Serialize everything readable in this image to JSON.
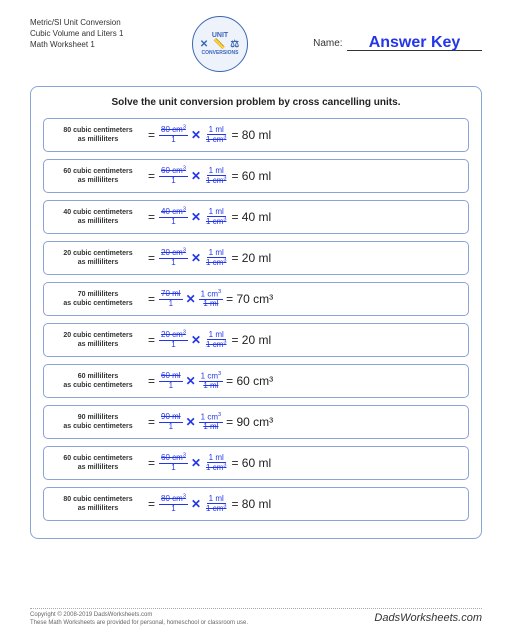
{
  "header": {
    "title_line1": "Metric/SI Unit Conversion",
    "title_line2": "Cubic Volume and Liters 1",
    "title_line3": "Math Worksheet 1",
    "logo_top": "UNIT",
    "logo_icons": "✕ 📏 ⚖",
    "logo_bottom": "CONVERSIONS",
    "name_label": "Name:",
    "answer_key": "Answer Key"
  },
  "instruction": "Solve the unit conversion problem by cross cancelling units.",
  "problems": [
    {
      "prompt_l1": "80 cubic centimeters",
      "prompt_l2": "as milliliters",
      "f1n": "80 cm",
      "f1n_sup": "3",
      "f1d": "1",
      "f2n": "1 ml",
      "f2d": "1 cm",
      "f2d_sup": "3",
      "result": "= 80 ml",
      "strike_a": "cm3",
      "strike_b": "cm3"
    },
    {
      "prompt_l1": "60 cubic centimeters",
      "prompt_l2": "as milliliters",
      "f1n": "60 cm",
      "f1n_sup": "3",
      "f1d": "1",
      "f2n": "1 ml",
      "f2d": "1 cm",
      "f2d_sup": "3",
      "result": "= 60 ml"
    },
    {
      "prompt_l1": "40 cubic centimeters",
      "prompt_l2": "as milliliters",
      "f1n": "40 cm",
      "f1n_sup": "3",
      "f1d": "1",
      "f2n": "1 ml",
      "f2d": "1 cm",
      "f2d_sup": "3",
      "result": "= 40 ml"
    },
    {
      "prompt_l1": "20 cubic centimeters",
      "prompt_l2": "as milliliters",
      "f1n": "20 cm",
      "f1n_sup": "3",
      "f1d": "1",
      "f2n": "1 ml",
      "f2d": "1 cm",
      "f2d_sup": "3",
      "result": "= 20 ml"
    },
    {
      "prompt_l1": "70 milliliters",
      "prompt_l2": "as cubic centimeters",
      "f1n": "70 ml",
      "f1n_sup": "",
      "f1d": "1",
      "f2n": "1 cm",
      "f2n_sup": "3",
      "f2d": "1 ml",
      "f2d_sup": "",
      "result": "= 70 cm³"
    },
    {
      "prompt_l1": "20 cubic centimeters",
      "prompt_l2": "as milliliters",
      "f1n": "20 cm",
      "f1n_sup": "3",
      "f1d": "1",
      "f2n": "1 ml",
      "f2d": "1 cm",
      "f2d_sup": "3",
      "result": "= 20 ml"
    },
    {
      "prompt_l1": "60 milliliters",
      "prompt_l2": "as cubic centimeters",
      "f1n": "60 ml",
      "f1n_sup": "",
      "f1d": "1",
      "f2n": "1 cm",
      "f2n_sup": "3",
      "f2d": "1 ml",
      "f2d_sup": "",
      "result": "= 60 cm³"
    },
    {
      "prompt_l1": "90 milliliters",
      "prompt_l2": "as cubic centimeters",
      "f1n": "90 ml",
      "f1n_sup": "",
      "f1d": "1",
      "f2n": "1 cm",
      "f2n_sup": "3",
      "f2d": "1 ml",
      "f2d_sup": "",
      "result": "= 90 cm³"
    },
    {
      "prompt_l1": "60 cubic centimeters",
      "prompt_l2": "as milliliters",
      "f1n": "60 cm",
      "f1n_sup": "3",
      "f1d": "1",
      "f2n": "1 ml",
      "f2d": "1 cm",
      "f2d_sup": "3",
      "result": "= 60 ml"
    },
    {
      "prompt_l1": "80 cubic centimeters",
      "prompt_l2": "as milliliters",
      "f1n": "80 cm",
      "f1n_sup": "3",
      "f1d": "1",
      "f2n": "1 ml",
      "f2d": "1 cm",
      "f2d_sup": "3",
      "result": "= 80 ml"
    }
  ],
  "footer": {
    "copyright_l1": "Copyright © 2008-2019 DadsWorksheets.com",
    "copyright_l2": "These Math Worksheets are provided for personal, homeschool or classroom use.",
    "brand": "DadsWorksheets.com"
  }
}
